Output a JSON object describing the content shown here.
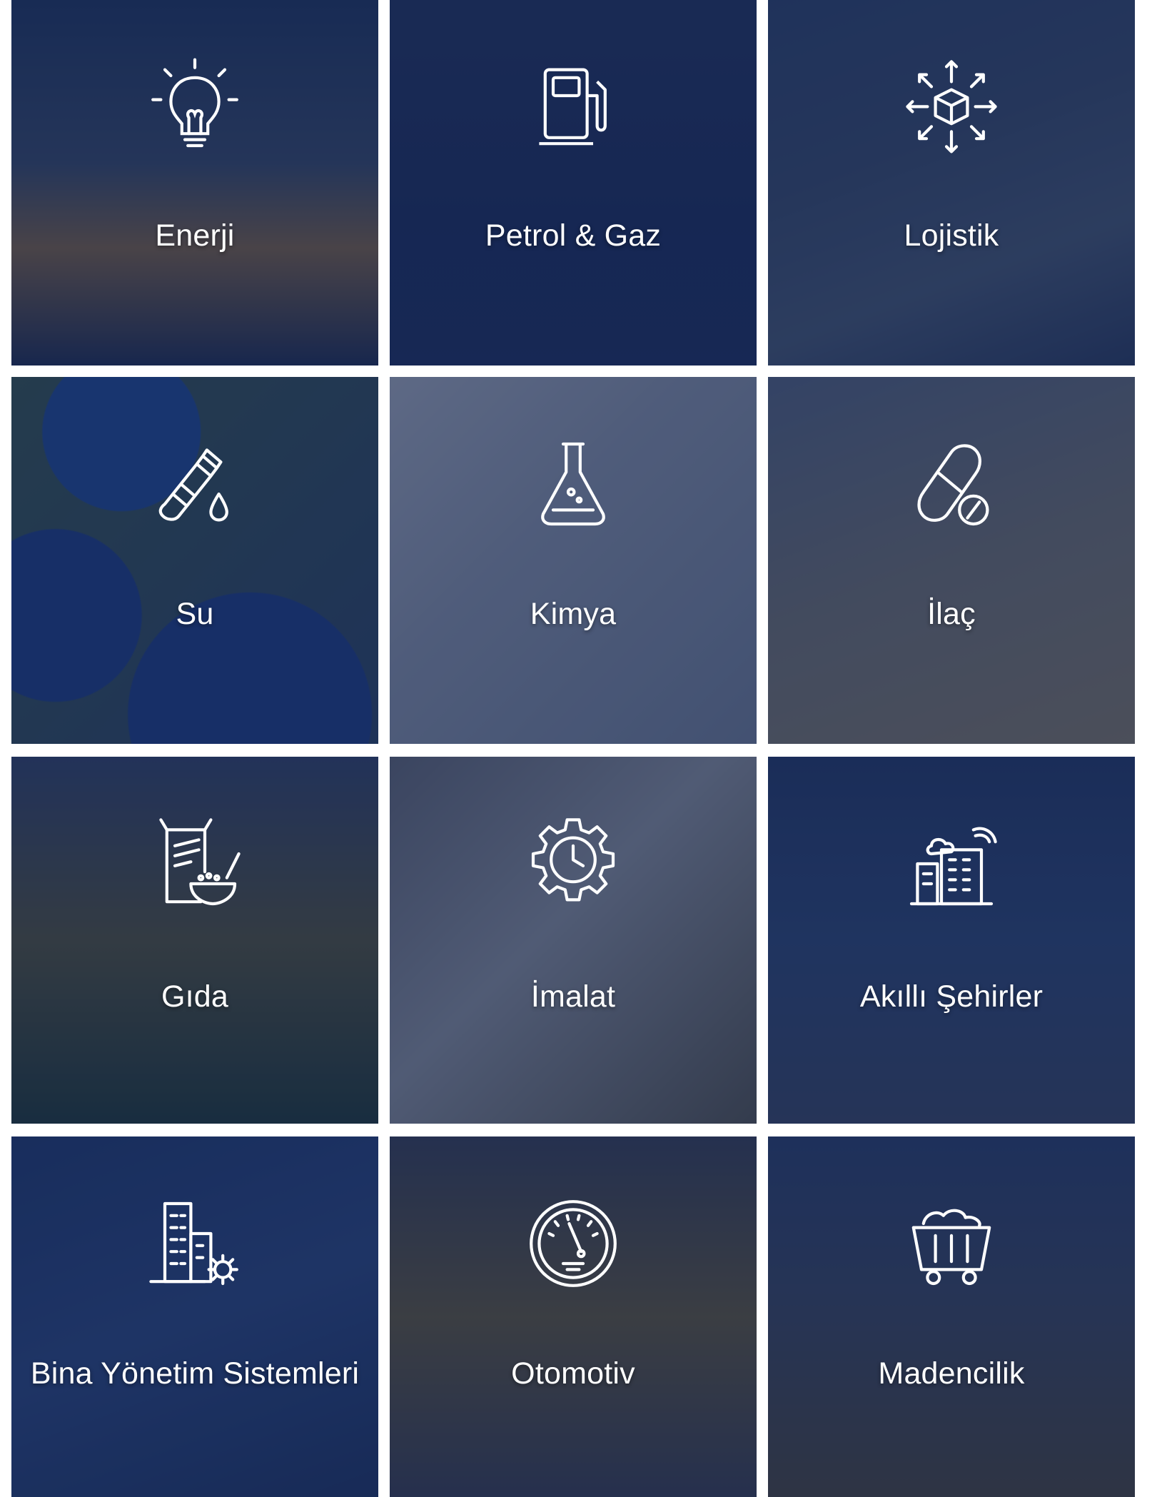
{
  "accent_overlay": "#14234b",
  "tiles": [
    {
      "label": "Enerji",
      "icon": "lightbulb-icon"
    },
    {
      "label": "Petrol & Gaz",
      "icon": "fuel-pump-icon"
    },
    {
      "label": "Lojistik",
      "icon": "box-arrows-icon"
    },
    {
      "label": "Su",
      "icon": "water-bottle-icon"
    },
    {
      "label": "Kimya",
      "icon": "flask-icon"
    },
    {
      "label": "İlaç",
      "icon": "pill-icon"
    },
    {
      "label": "Gıda",
      "icon": "food-jar-icon"
    },
    {
      "label": "İmalat",
      "icon": "gear-clock-icon"
    },
    {
      "label": "Akıllı Şehirler",
      "icon": "smart-building-icon"
    },
    {
      "label": "Bina Yönetim Sistemleri",
      "icon": "building-gear-icon"
    },
    {
      "label": "Otomotiv",
      "icon": "speedometer-icon"
    },
    {
      "label": "Madencilik",
      "icon": "mine-cart-icon"
    }
  ]
}
